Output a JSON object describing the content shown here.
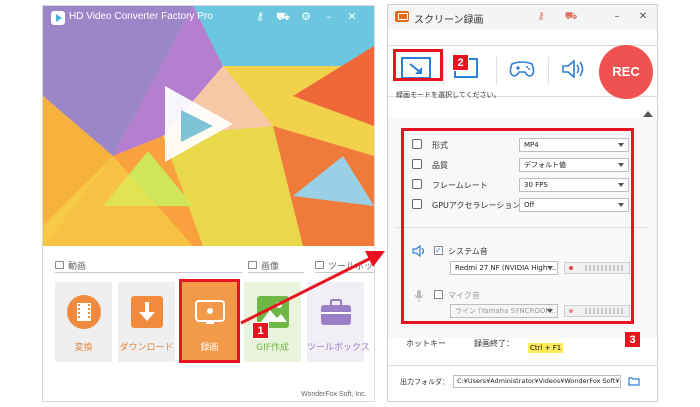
{
  "main_window": {
    "title": "HD Video Converter Factory Pro",
    "sections": {
      "video": "動画",
      "image": "画像",
      "toolbox": "ツールボックス"
    },
    "tiles": [
      {
        "id": "convert",
        "label": "変換",
        "icon": "film-icon"
      },
      {
        "id": "download",
        "label": "ダウンロード",
        "icon": "download-icon"
      },
      {
        "id": "record",
        "label": "録画",
        "icon": "screen-record-icon"
      },
      {
        "id": "gif",
        "label": "GIF作成",
        "icon": "image-icon"
      },
      {
        "id": "toolbox",
        "label": "ツールボックス",
        "icon": "toolbox-icon"
      }
    ],
    "footer_brand": "WonderFox Soft, Inc."
  },
  "recorder_window": {
    "title": "スクリーン録画",
    "rec_label": "REC",
    "mode_hint": "録画モードを選択してください。",
    "settings": {
      "format": {
        "label": "形式",
        "value": "MP4"
      },
      "quality": {
        "label": "品質",
        "value": "デフォルト値"
      },
      "frame_rate": {
        "label": "フレームレート",
        "value": "30 FPS"
      },
      "gpu": {
        "label": "GPUアクセラレーション",
        "value": "Off"
      }
    },
    "audio": {
      "system": {
        "label": "システム音",
        "checked": true,
        "device": "Redmi 27 NF (NVIDIA High ..."
      },
      "mic": {
        "label": "マイク音",
        "checked": false,
        "device": "ライン (Yamaha SYNCROOM..."
      }
    },
    "hotkey": {
      "label": "ホットキー",
      "end_label": "録画終了：",
      "value": "Ctrl + F1"
    },
    "output": {
      "label": "出力フォルダ：",
      "path": "C:¥Users¥Administrator¥Videos¥WonderFox Soft¥HD V"
    }
  },
  "annotations": {
    "badge1": "1",
    "badge2": "2",
    "badge3": "3"
  },
  "colors": {
    "accent_red": "#e8131e",
    "rec_red": "#f05252",
    "tile_orange": "#e2853a",
    "hotkey_highlight": "#ffe95a"
  }
}
